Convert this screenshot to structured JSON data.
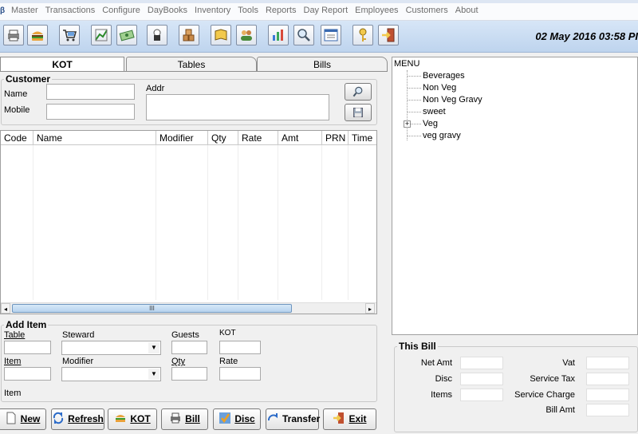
{
  "menubar": {
    "items": [
      "Master",
      "Transactions",
      "Configure",
      "DayBooks",
      "Inventory",
      "Tools",
      "Reports",
      "Day Report",
      "Employees",
      "Customers",
      "About"
    ]
  },
  "toolbar": {
    "icons": [
      "printer-icon",
      "burger-icon",
      "cart-icon",
      "chart-icon",
      "money-icon",
      "chef-icon",
      "boxes-icon",
      "book-icon",
      "people-icon",
      "bar-chart-icon",
      "search-icon",
      "report-icon",
      "key-icon",
      "exit-icon"
    ],
    "datetime": "02 May 2016 03:58 PI"
  },
  "tabs": [
    "KOT",
    "Tables",
    "Bills"
  ],
  "customer": {
    "legend": "Customer",
    "name_label": "Name",
    "mobile_label": "Mobile",
    "addr_label": "Addr"
  },
  "grid": {
    "columns": [
      "Code",
      "Name",
      "Modifier",
      "Qty",
      "Rate",
      "Amt",
      "PRN",
      "Time"
    ],
    "rows": [],
    "scroll_thumb_label": "III"
  },
  "add_item": {
    "legend": "Add Item",
    "table_label": "Table",
    "steward_label": "Steward",
    "guests_label": "Guests",
    "kot_label": "KOT",
    "item_label": "Item",
    "modifier_label": "Modifier",
    "qty_label": "Qty",
    "rate_label": "Rate",
    "item_status": "Item"
  },
  "buttons": {
    "new": "New",
    "refresh": "Refresh",
    "kot": "KOT",
    "bill": "Bill",
    "disc": "Disc",
    "transfer": "Transfer",
    "exit": "Exit"
  },
  "menu_tree": {
    "root": "MENU",
    "children": [
      "Beverages",
      "Non Veg",
      "Non Veg Gravy",
      "sweet",
      "Veg",
      "veg gravy"
    ]
  },
  "this_bill": {
    "legend": "This Bill",
    "net_amt": "Net Amt",
    "disc": "Disc",
    "items": "Items",
    "vat": "Vat",
    "service_tax": "Service Tax",
    "service_charge": "Service Charge",
    "bill_amt": "Bill Amt"
  },
  "colors": {
    "toolbar_top": "#d7e6f7",
    "toolbar_bottom": "#bed4ee",
    "scroll_thumb": "#b7d3ee"
  }
}
